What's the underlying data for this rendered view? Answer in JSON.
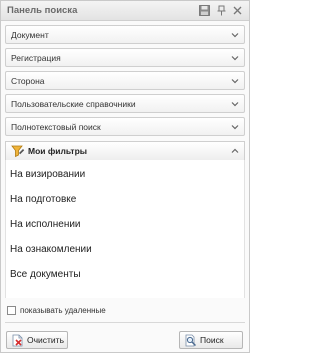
{
  "panel": {
    "title": "Панель поиска",
    "icons": [
      "save-icon",
      "pin-icon",
      "close-icon"
    ]
  },
  "sections": [
    {
      "label": "Документ",
      "icon": "chevron-down-icon"
    },
    {
      "label": "Регистрация",
      "icon": "chevron-down-icon"
    },
    {
      "label": "Сторона",
      "icon": "chevron-down-icon"
    },
    {
      "label": "Пользовательские справочники",
      "icon": "chevron-down-icon"
    },
    {
      "label": "Полнотекстовый поиск",
      "icon": "chevron-down-icon"
    }
  ],
  "filters": {
    "title": "Мои фильтры",
    "icon": "filter-icon",
    "items": [
      "На визировании",
      "На подготовке",
      "На исполнении",
      "На ознакомлении",
      "Все документы"
    ]
  },
  "show_deleted": {
    "label": "показывать удаленные",
    "checked": false
  },
  "buttons": {
    "clear_label": "Очистить",
    "search_label": "Поиск"
  }
}
